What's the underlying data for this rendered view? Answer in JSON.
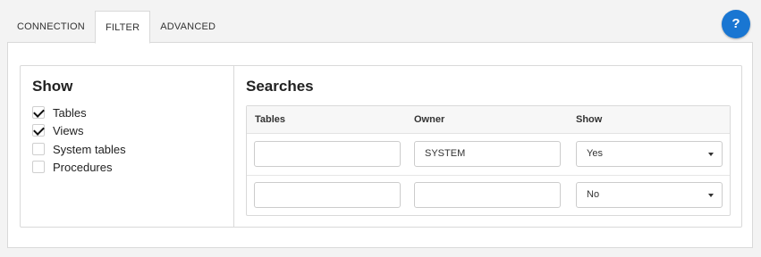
{
  "tabs": [
    {
      "label": "CONNECTION",
      "active": false
    },
    {
      "label": "FILTER",
      "active": true
    },
    {
      "label": "ADVANCED",
      "active": false
    }
  ],
  "help": {
    "label": "?"
  },
  "show": {
    "title": "Show",
    "items": [
      {
        "label": "Tables",
        "checked": true
      },
      {
        "label": "Views",
        "checked": true
      },
      {
        "label": "System tables",
        "checked": false
      },
      {
        "label": "Procedures",
        "checked": false
      }
    ]
  },
  "searches": {
    "title": "Searches",
    "columns": [
      "Tables",
      "Owner",
      "Show"
    ],
    "rows": [
      {
        "tables": "",
        "owner": "SYSTEM",
        "show": "Yes"
      },
      {
        "tables": "",
        "owner": "",
        "show": "No"
      }
    ]
  },
  "colors": {
    "accent": "#1976d2",
    "border": "#d9d9d9"
  }
}
